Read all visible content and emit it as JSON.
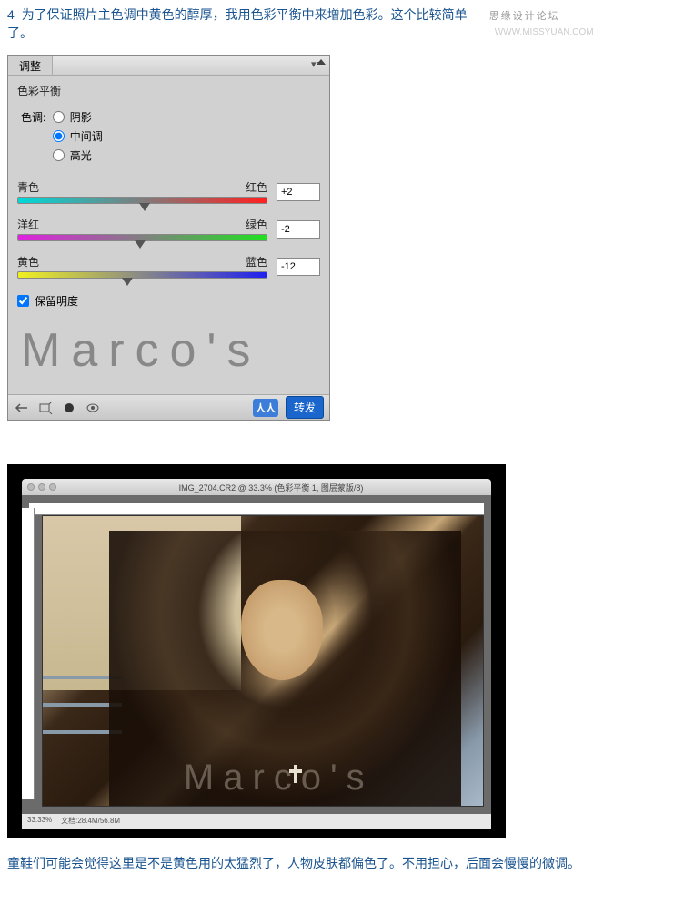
{
  "header": {
    "step_num": "4",
    "instruction": "为了保证照片主色调中黄色的醇厚，我用色彩平衡中来增加色彩。这个比较简单了。",
    "watermark": "思缘设计论坛",
    "watermark_url": "WWW.MISSYUAN.COM"
  },
  "panel": {
    "tab_label": "调整",
    "menu_icon": "▾≡",
    "title": "色彩平衡",
    "tone_label": "色调:",
    "tone_options": {
      "shadows": "阴影",
      "midtones": "中间调",
      "highlights": "高光"
    },
    "tone_selected": "midtones",
    "sliders": {
      "cyan_red": {
        "left": "青色",
        "right": "红色",
        "value": "+2",
        "pos": 51
      },
      "magenta_green": {
        "left": "洋红",
        "right": "绿色",
        "value": "-2",
        "pos": 49
      },
      "yellow_blue": {
        "left": "黄色",
        "right": "蓝色",
        "value": "-12",
        "pos": 44
      }
    },
    "preserve_luminosity": "保留明度",
    "preserve_checked": true,
    "marcos": "Marco's",
    "footer": {
      "renren": "人人",
      "forward": "转发"
    }
  },
  "photo": {
    "mac_title": "IMG_2704.CR2 @ 33.3% (色彩平衡 1, 图层蒙版/8)",
    "marcos": "Marco's",
    "status_zoom": "33.33%",
    "status_info": "文档:28.4M/56.8M"
  },
  "footer_text": "童鞋们可能会觉得这里是不是黄色用的太猛烈了，人物皮肤都偏色了。不用担心，后面会慢慢的微调。"
}
